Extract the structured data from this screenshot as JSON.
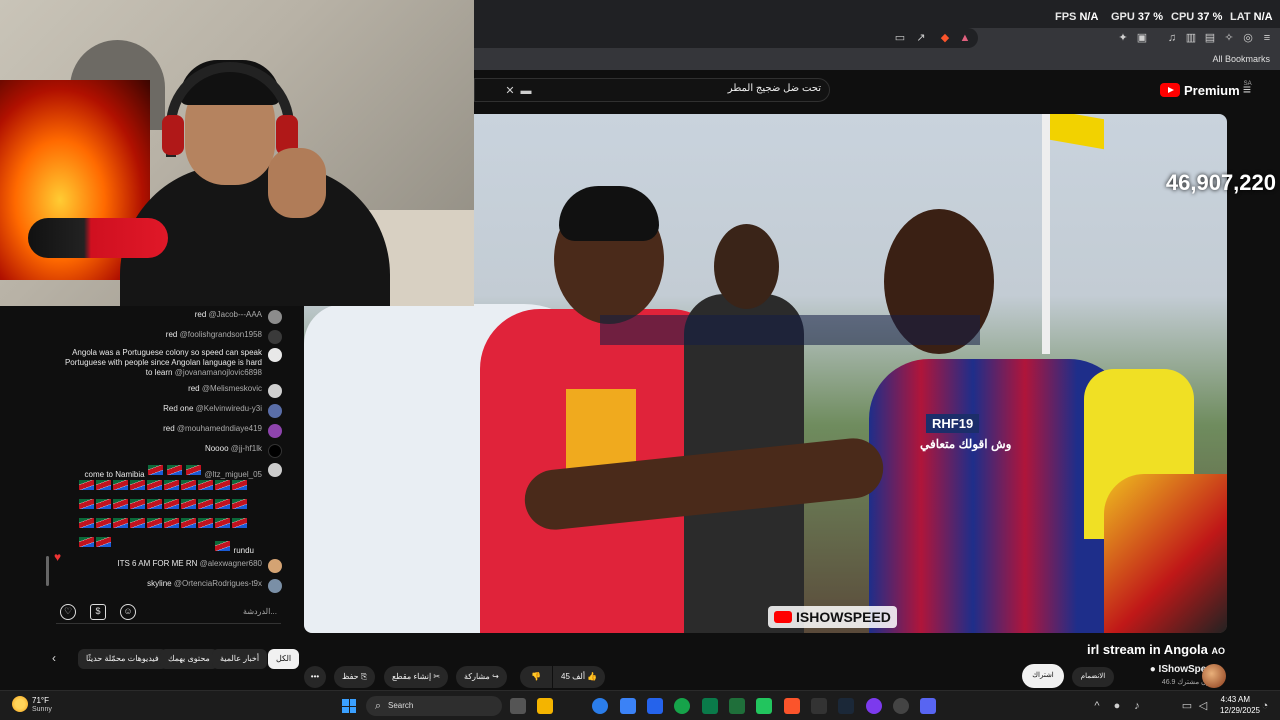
{
  "webcam": {},
  "browser": {
    "stats": [
      {
        "label": "FPS",
        "value": "N/A"
      },
      {
        "label": "GPU",
        "value": "37 %"
      },
      {
        "label": "CPU",
        "value": "37 %"
      },
      {
        "label": "LAT",
        "value": "N/A"
      }
    ],
    "bookmarks_label": "All Bookmarks"
  },
  "youtube": {
    "search_query": "تحت ضل ضجيج المطر",
    "logo_word": "Premium",
    "logo_region": "SA"
  },
  "video": {
    "counter": "46,907,220",
    "subtitle_user": "RHF19",
    "subtitle_text": "وش اقولك متعافي",
    "watermark": "ISHOWSPEED"
  },
  "chat": {
    "messages": [
      {
        "user": "@Jacob---AAA",
        "text": "red",
        "color": "#8c8c8c"
      },
      {
        "user": "@foolishgrandson1958",
        "text": "red",
        "color": "#3a3a3a"
      },
      {
        "user": "@jovanamanojlovic6898",
        "text": "Angola was a Portuguese colony so speed can speak Portuguese with people since Angolan language is hard to learn",
        "color": "#e8e8e8"
      },
      {
        "user": "@Melismeskovic",
        "text": "red",
        "color": "#cfcfcf"
      },
      {
        "user": "@Kelvinwiredu-y3i",
        "text": "Red one",
        "color": "#5a6ea8"
      },
      {
        "user": "@mouhamedndiaye419",
        "text": "red",
        "color": "#8e44ad"
      },
      {
        "user": "@jj-hf1lk",
        "text": "Noooo",
        "color": "#000000"
      },
      {
        "user": "@ltz_miguel_05",
        "text": "come to Namibia",
        "color": "#cccccc"
      },
      {
        "user": "",
        "text": "rundu",
        "color": ""
      },
      {
        "user": "@alexwagner680",
        "text": "ITS 6 AM FOR ME RN",
        "color": "#d4a373"
      },
      {
        "user": "@OrtenciaRodrigues-t9x",
        "text": "skyline",
        "color": "#7a8fa6"
      }
    ],
    "input_placeholder": "الدردشة..."
  },
  "below": {
    "title": "irl stream in Angola",
    "title_flag": "AO",
    "chips": [
      "الكل",
      "أخبار عالمية",
      "محتوى يهمك",
      "فيديوهات محمّلة حديثًا"
    ],
    "actions": {
      "more": "•••",
      "save": "حفظ",
      "clip": "إنشاء مقطع",
      "share": "مشاركة",
      "dislike": "",
      "like_count": "45 ألف"
    },
    "channel_name": "IShowSpeed",
    "subscribers": "46.9 مليون مشترك",
    "join": "الانضمام",
    "subscribed": "اشتراك"
  },
  "taskbar": {
    "temp": "71°F",
    "condition": "Sunny",
    "search_label": "Search",
    "time": "4:43 AM",
    "date": "12/29/2025"
  }
}
